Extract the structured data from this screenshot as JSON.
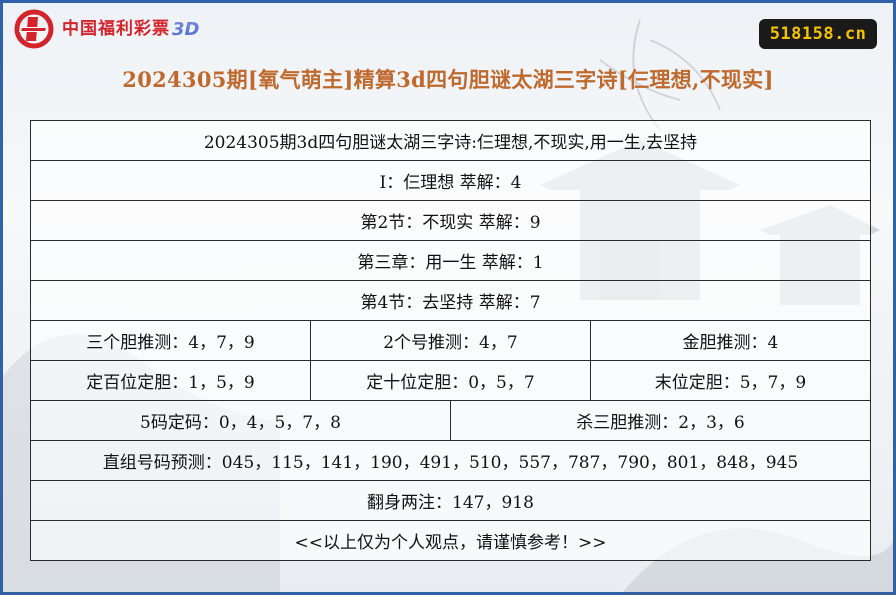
{
  "header": {
    "logo_text": "中国福利彩票",
    "logo_suffix": "3D",
    "site_badge": "518158.cn"
  },
  "title": "2024305期[氧气萌主]精算3d四句胆谜太湖三字诗[仨理想,不现实]",
  "table": {
    "row_poem": "2024305期3d四句胆谜太湖三字诗:仨理想,不现实,用一生,去坚持",
    "row_line1": "I：仨理想 萃解：4",
    "row_line2": "第2节：不现实 萃解：9",
    "row_line3": "第三章：用一生 萃解：1",
    "row_line4": "第4节：去坚持 萃解：7",
    "three_dan": "三个胆推测：4，7，9",
    "two_num": "2个号推测：4，7",
    "gold_dan": "金胆推测：4",
    "hundreds": "定百位定胆：1，5，9",
    "tens": "定十位定胆：0，5，7",
    "units": "末位定胆：5，7，9",
    "five_code": "5码定码：0，4，5，7，8",
    "kill_three": "杀三胆推测：2，3，6",
    "direct": "直组号码预测：045，115，141，190，491，510，557，787，790，801，848，945",
    "flip": "翻身两注：147，918",
    "disclaimer": "<<以上仅为个人观点，请谨慎参考！>>"
  },
  "colors": {
    "border": "#2f62a8",
    "title": "#c0692d",
    "badge_bg": "#1a1a1a",
    "badge_text": "#f4c200",
    "logo_red": "#d4232a"
  }
}
